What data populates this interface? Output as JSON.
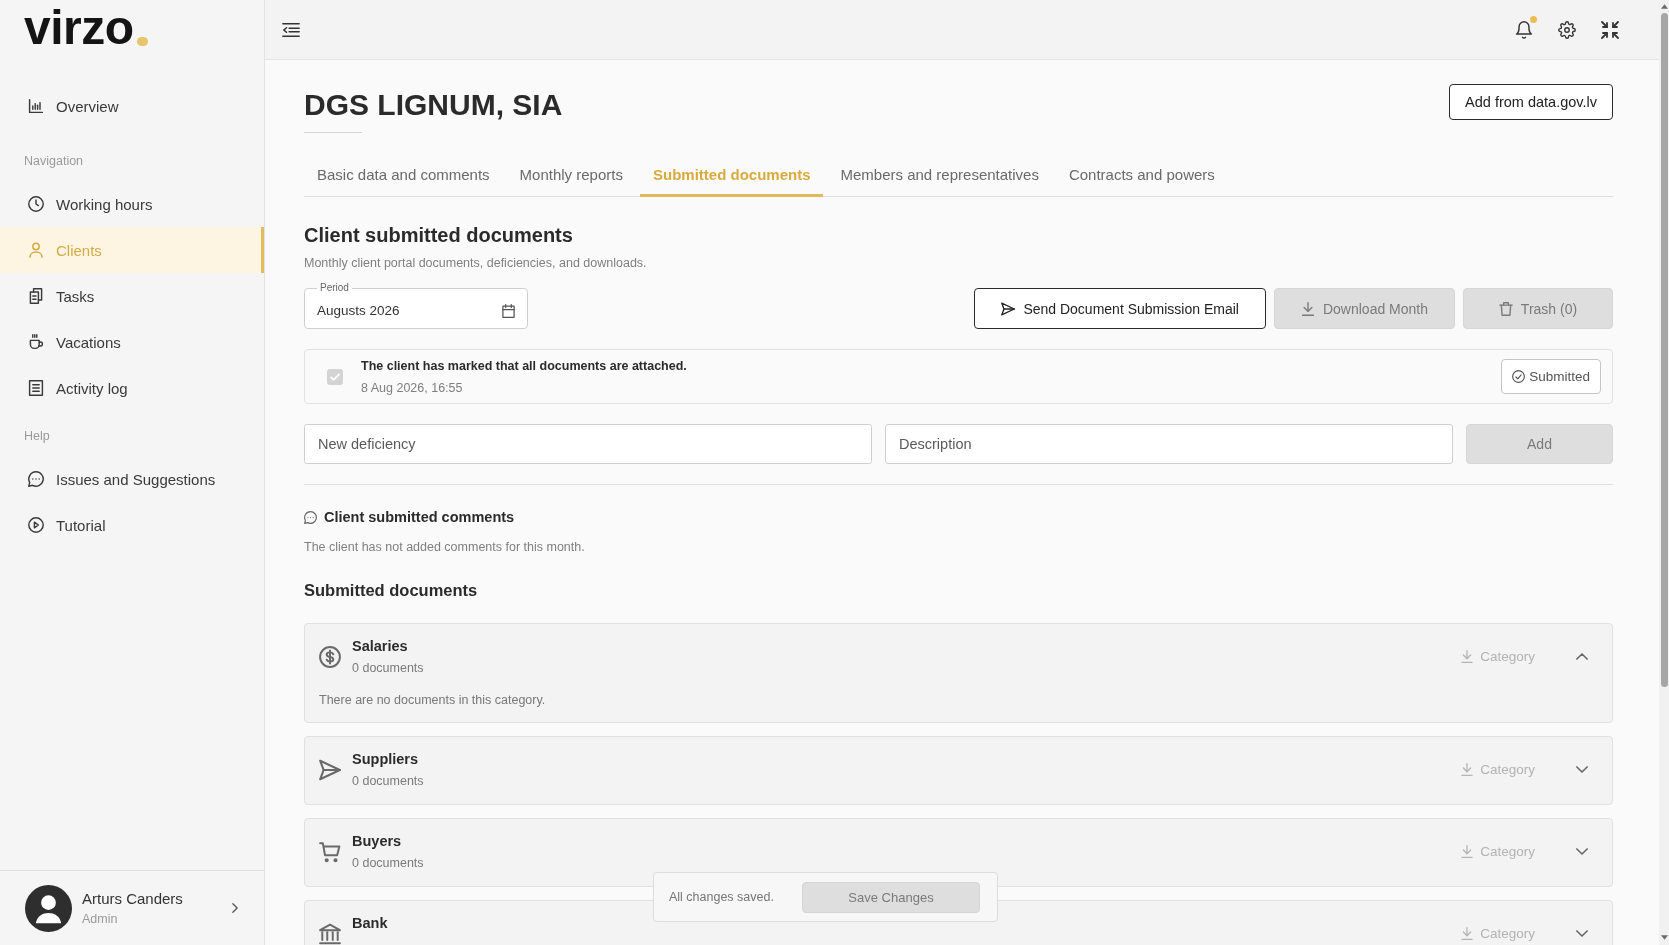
{
  "sidebar": {
    "logo": "virzo",
    "items": [
      {
        "kind": "link",
        "label": "Overview",
        "selected": false
      },
      {
        "kind": "section",
        "label": "Navigation"
      },
      {
        "kind": "link",
        "label": "Working hours",
        "selected": false
      },
      {
        "kind": "link",
        "label": "Clients",
        "selected": true
      },
      {
        "kind": "link",
        "label": "Tasks",
        "selected": false
      },
      {
        "kind": "link",
        "label": "Vacations",
        "selected": false
      },
      {
        "kind": "link",
        "label": "Activity log",
        "selected": false
      },
      {
        "kind": "section",
        "label": "Help"
      },
      {
        "kind": "link",
        "label": "Issues and Suggestions",
        "selected": false
      },
      {
        "kind": "link",
        "label": "Tutorial",
        "selected": false
      }
    ],
    "user": {
      "name": "Arturs Canders",
      "role": "Admin"
    }
  },
  "top_bar": {
    "notifications": {
      "unread": true
    }
  },
  "page": {
    "title": "DGS LIGNUM, SIA",
    "action": "Add from data.gov.lv"
  },
  "tabs": [
    {
      "label": "Basic data and comments",
      "selected": false
    },
    {
      "label": "Monthly reports",
      "selected": false
    },
    {
      "label": "Submitted documents",
      "selected": true
    },
    {
      "label": "Members and representatives",
      "selected": false
    },
    {
      "label": "Contracts and powers",
      "selected": false
    }
  ],
  "documents_panel": {
    "title": "Client submitted documents",
    "subtitle": "Monthly client portal documents, deficiencies, and downloads.",
    "period": {
      "label": "Period",
      "value": "Augusts 2026"
    },
    "actions": [
      {
        "label": "Send Document Submission Email",
        "disabled": false
      },
      {
        "label": "Download Month",
        "disabled": true
      },
      {
        "label": "Trash (0)",
        "disabled": true
      }
    ],
    "confirmation": {
      "checked": true,
      "disabled": true,
      "text": "The client has marked that all documents are attached.",
      "date": "8 Aug 2026, 16:55",
      "status": "Submitted"
    },
    "deficiency_form": {
      "name_placeholder": "New deficiency",
      "description_placeholder": "Description",
      "submit": {
        "label": "Add",
        "disabled": true
      }
    },
    "comments": {
      "title": "Client submitted comments",
      "empty_text": "The client has not added comments for this month."
    },
    "submitted": {
      "title": "Submitted documents",
      "categories": [
        {
          "name": "Salaries",
          "count": "0 documents",
          "download": {
            "label": "Category",
            "disabled": true
          },
          "expanded": true,
          "empty_text": "There are no documents in this category."
        },
        {
          "name": "Suppliers",
          "count": "0 documents",
          "download": {
            "label": "Category",
            "disabled": true
          },
          "expanded": false
        },
        {
          "name": "Buyers",
          "count": "0 documents",
          "download": {
            "label": "Category",
            "disabled": true
          },
          "expanded": false
        },
        {
          "name": "Bank",
          "download": {
            "label": "Category",
            "disabled": true
          },
          "expanded": false
        }
      ]
    }
  },
  "save_bar": {
    "status": "All changes saved.",
    "button": {
      "label": "Save Changes",
      "disabled": true
    }
  }
}
